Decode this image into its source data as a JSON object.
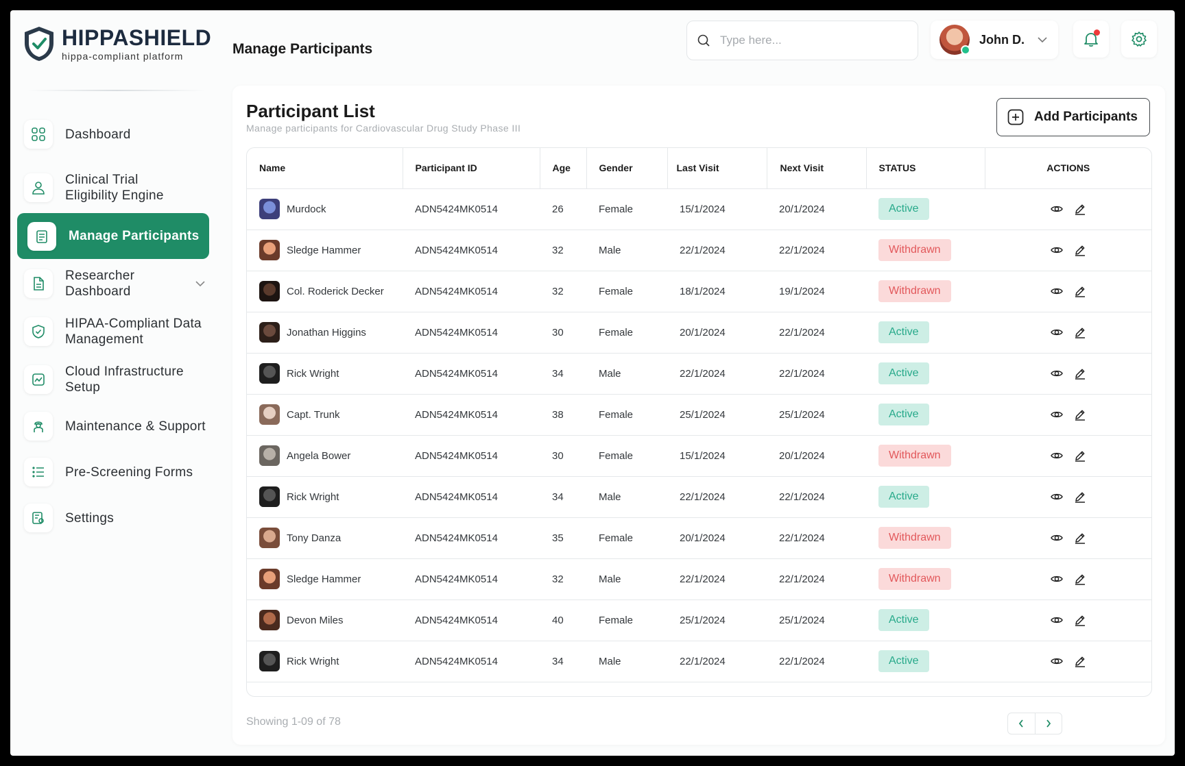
{
  "brand": {
    "name": "HIPPASHIELD",
    "tagline": "hippa-compliant platform"
  },
  "header": {
    "title": "Manage Participants",
    "search_placeholder": "Type here...",
    "user_name": "John D."
  },
  "sidebar": {
    "items": [
      {
        "label": "Dashboard",
        "icon": "grid-icon"
      },
      {
        "label": "Clinical Trial Eligibility Engine",
        "icon": "user-icon"
      },
      {
        "label": "Manage Participants",
        "icon": "clipboard-icon"
      },
      {
        "label": "Researcher Dashboard",
        "icon": "document-icon"
      },
      {
        "label": "HIPAA-Compliant Data Management",
        "icon": "shield-check-icon"
      },
      {
        "label": "Cloud Infrastructure Setup",
        "icon": "chart-icon"
      },
      {
        "label": "Maintenance & Support",
        "icon": "worker-icon"
      },
      {
        "label": "Pre-Screening Forms",
        "icon": "list-icon"
      },
      {
        "label": "Settings",
        "icon": "settings-doc-icon"
      }
    ]
  },
  "main": {
    "title": "Participant List",
    "subtitle": "Manage participants for Cardiovascular Drug Study Phase III",
    "add_button": "Add Participants",
    "columns": [
      "Name",
      "Participant ID",
      "Age",
      "Gender",
      "Last Visit",
      "Next Visit",
      "STATUS",
      "ACTIONS"
    ],
    "rows": [
      {
        "name": "Murdock",
        "id": "ADN5424MK0514",
        "age": "26",
        "gender": "Female",
        "last": "15/1/2024",
        "next": "20/1/2024",
        "status": "Active"
      },
      {
        "name": "Sledge Hammer",
        "id": "ADN5424MK0514",
        "age": "32",
        "gender": "Male",
        "last": "22/1/2024",
        "next": "22/1/2024",
        "status": "Withdrawn"
      },
      {
        "name": "Col. Roderick Decker",
        "id": "ADN5424MK0514",
        "age": "32",
        "gender": "Female",
        "last": "18/1/2024",
        "next": "19/1/2024",
        "status": "Withdrawn"
      },
      {
        "name": "Jonathan Higgins",
        "id": "ADN5424MK0514",
        "age": "30",
        "gender": "Female",
        "last": "20/1/2024",
        "next": "22/1/2024",
        "status": "Active"
      },
      {
        "name": "Rick Wright",
        "id": "ADN5424MK0514",
        "age": "34",
        "gender": "Male",
        "last": "22/1/2024",
        "next": "22/1/2024",
        "status": "Active"
      },
      {
        "name": "Capt. Trunk",
        "id": "ADN5424MK0514",
        "age": "38",
        "gender": "Female",
        "last": "25/1/2024",
        "next": "25/1/2024",
        "status": "Active"
      },
      {
        "name": "Angela Bower",
        "id": "ADN5424MK0514",
        "age": "30",
        "gender": "Female",
        "last": "15/1/2024",
        "next": "20/1/2024",
        "status": "Withdrawn"
      },
      {
        "name": "Rick Wright",
        "id": "ADN5424MK0514",
        "age": "34",
        "gender": "Male",
        "last": "22/1/2024",
        "next": "22/1/2024",
        "status": "Active"
      },
      {
        "name": "Tony Danza",
        "id": "ADN5424MK0514",
        "age": "35",
        "gender": "Female",
        "last": "20/1/2024",
        "next": "22/1/2024",
        "status": "Withdrawn"
      },
      {
        "name": "Sledge Hammer",
        "id": "ADN5424MK0514",
        "age": "32",
        "gender": "Male",
        "last": "22/1/2024",
        "next": "22/1/2024",
        "status": "Withdrawn"
      },
      {
        "name": "Devon Miles",
        "id": "ADN5424MK0514",
        "age": "40",
        "gender": "Female",
        "last": "25/1/2024",
        "next": "25/1/2024",
        "status": "Active"
      },
      {
        "name": "Rick Wright",
        "id": "ADN5424MK0514",
        "age": "34",
        "gender": "Male",
        "last": "22/1/2024",
        "next": "22/1/2024",
        "status": "Active"
      }
    ],
    "showing": "Showing 1-09 of 78"
  },
  "colors": {
    "accent": "#1f8c66",
    "active_bg": "#cdeee5",
    "active_fg": "#27a98a",
    "withdrawn_bg": "#fbdada",
    "withdrawn_fg": "#e2585b"
  }
}
